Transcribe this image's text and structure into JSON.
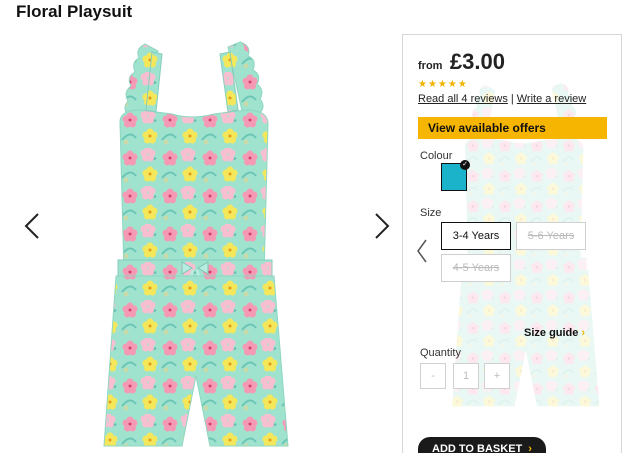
{
  "product": {
    "title": "Floral Playsuit"
  },
  "gallery": {
    "prev_icon": "chevron-left-icon",
    "next_icon": "chevron-right-icon"
  },
  "panel": {
    "price_prefix": "from",
    "price": "£3.00",
    "rating": {
      "stars": "★★★★★",
      "value_of_5": 5
    },
    "reviews_link": "Read all 4 reviews",
    "separator": "|",
    "write_review_link": "Write a review",
    "offers_button": "View available offers",
    "colour_label": "Colour",
    "colour_swatch": {
      "color": "#1ab3c9",
      "selected": true,
      "check": "✓"
    },
    "size_label": "Size",
    "sizes": [
      {
        "label": "3-4 Years",
        "state": "selected"
      },
      {
        "label": "5-6 Years",
        "state": "unavailable"
      },
      {
        "label": "4-5 Years",
        "state": "unavailable"
      }
    ],
    "size_guide": "Size guide",
    "size_guide_arrow": "›",
    "quantity_label": "Quantity",
    "quantity": {
      "minus": "-",
      "value": "1",
      "plus": "+"
    },
    "add_to_basket": "ADD TO BASKET",
    "add_to_basket_arrow": "›"
  },
  "colors": {
    "accent_yellow": "#f6b500",
    "garment_mint": "#9fe3cf",
    "dark": "#1a1a1a"
  }
}
